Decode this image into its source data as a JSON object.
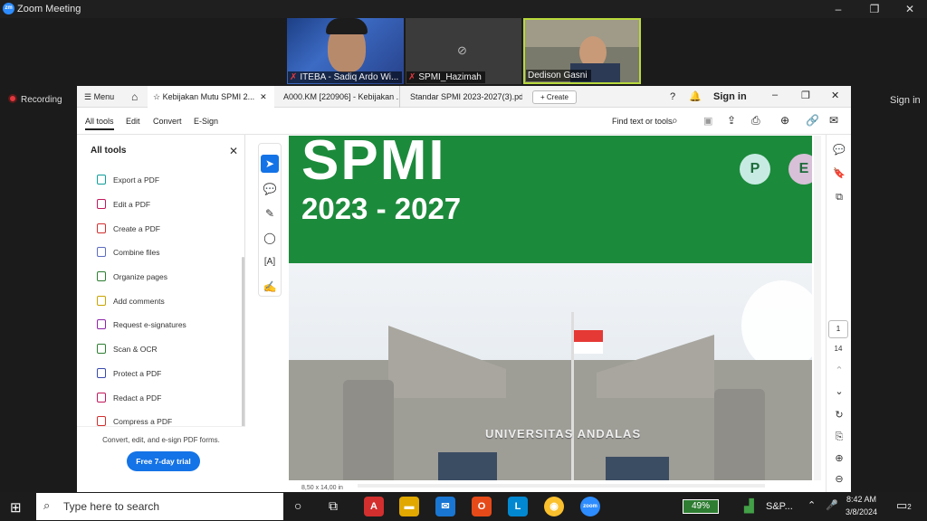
{
  "zoom": {
    "title": "Zoom Meeting",
    "logo_text": "zm",
    "recording_label": "Recording",
    "sign_in": "Sign in",
    "participants": [
      {
        "name": "ITEBA - Sadiq Ardo Wi..."
      },
      {
        "name": "SPMI_Hazimah"
      },
      {
        "name": "Dedison Gasni"
      }
    ]
  },
  "acrobat": {
    "menu_label": "Menu",
    "tabs": [
      {
        "label": "Kebijakan Mutu SPMI 2..."
      },
      {
        "label": "A000.KM [220906] - Kebijakan ..."
      },
      {
        "label": "Standar SPMI 2023-2027(3).pdf"
      }
    ],
    "create_label": "Create",
    "sign_in": "Sign in",
    "toolbar": {
      "all_tools": "All tools",
      "edit": "Edit",
      "convert": "Convert",
      "esign": "E-Sign",
      "find": "Find text or tools"
    },
    "tools_panel": {
      "title": "All tools",
      "items": [
        {
          "label": "Export a PDF",
          "color": "#0f9d9a"
        },
        {
          "label": "Edit a PDF",
          "color": "#c2185b"
        },
        {
          "label": "Create a PDF",
          "color": "#d32f2f"
        },
        {
          "label": "Combine files",
          "color": "#5c6bc0"
        },
        {
          "label": "Organize pages",
          "color": "#2e7d32"
        },
        {
          "label": "Add comments",
          "color": "#c9a400"
        },
        {
          "label": "Request e-signatures",
          "color": "#8e24aa"
        },
        {
          "label": "Scan & OCR",
          "color": "#2e7d32"
        },
        {
          "label": "Protect a PDF",
          "color": "#3949ab"
        },
        {
          "label": "Redact a PDF",
          "color": "#c2185b"
        },
        {
          "label": "Compress a PDF",
          "color": "#d32f2f"
        }
      ],
      "convert_note": "Convert, edit, and e-sign PDF forms.",
      "trial_button": "Free 7-day trial"
    },
    "document": {
      "title": "SPMI",
      "years": "2023 - 2027",
      "circle_p": "P",
      "circle_e": "E",
      "building_text": "UNIVERSITAS ANDALAS",
      "page_size": "8,50 x 14,00 in"
    },
    "page_number": "1",
    "page_total": "14"
  },
  "taskbar": {
    "search_placeholder": "Type here to search",
    "battery": "49%",
    "stocks": "S&P...",
    "time": "8:42 AM",
    "date": "3/8/2024",
    "notifications": "2"
  }
}
